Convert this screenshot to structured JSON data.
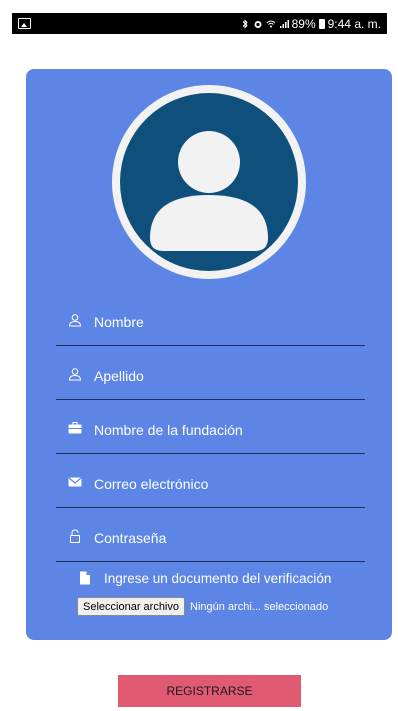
{
  "status_bar": {
    "battery": "89%",
    "time": "9:44 a. m."
  },
  "form": {
    "fields": [
      {
        "placeholder": "Nombre",
        "icon": "person-outline-icon"
      },
      {
        "placeholder": "Apellido",
        "icon": "person-outline-icon"
      },
      {
        "placeholder": "Nombre de la fundación",
        "icon": "briefcase-icon"
      },
      {
        "placeholder": "Correo electrónico",
        "icon": "mail-icon"
      },
      {
        "placeholder": "Contraseña",
        "icon": "lock-icon"
      }
    ],
    "document_label": "Ingrese un documento del verificación",
    "file_button": "Seleccionar archivo",
    "file_status": "Ningún archi... seleccionado",
    "submit_label": "REGISTRARSE"
  },
  "colors": {
    "card": "#5c85e5",
    "avatar": "#0e4f7c",
    "submit": "#e05a72"
  }
}
